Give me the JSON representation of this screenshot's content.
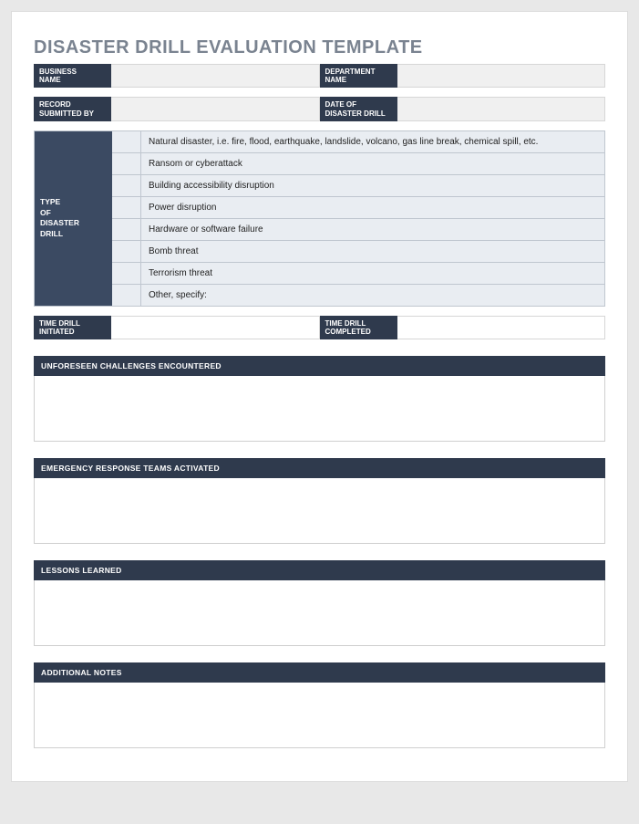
{
  "title": "DISASTER DRILL EVALUATION TEMPLATE",
  "row_business": {
    "label1": "BUSINESS\nNAME",
    "value1": "",
    "label2": "DEPARTMENT\nNAME",
    "value2": ""
  },
  "row_record": {
    "label1": "RECORD\nSUBMITTED BY",
    "value1": "",
    "label2": "DATE OF\nDISASTER DRILL",
    "value2": ""
  },
  "type_block": {
    "label": "TYPE\nOF\nDISASTER\nDRILL",
    "items": [
      "Natural disaster, i.e. fire, flood, earthquake, landslide, volcano, gas line break, chemical spill, etc.",
      "Ransom or cyberattack",
      "Building accessibility disruption",
      "Power disruption",
      "Hardware or software failure",
      "Bomb threat",
      "Terrorism threat",
      "Other, specify:"
    ]
  },
  "row_time": {
    "label1": "TIME DRILL\nINITIATED",
    "value1": "",
    "label2": "TIME DRILL\nCOMPLETED",
    "value2": ""
  },
  "sections": {
    "unforeseen": {
      "header": "UNFORESEEN CHALLENGES ENCOUNTERED",
      "body": ""
    },
    "response": {
      "header": "EMERGENCY RESPONSE TEAMS ACTIVATED",
      "body": ""
    },
    "lessons": {
      "header": "LESSONS LEARNED",
      "body": ""
    },
    "notes": {
      "header": "ADDITIONAL NOTES",
      "body": ""
    }
  }
}
